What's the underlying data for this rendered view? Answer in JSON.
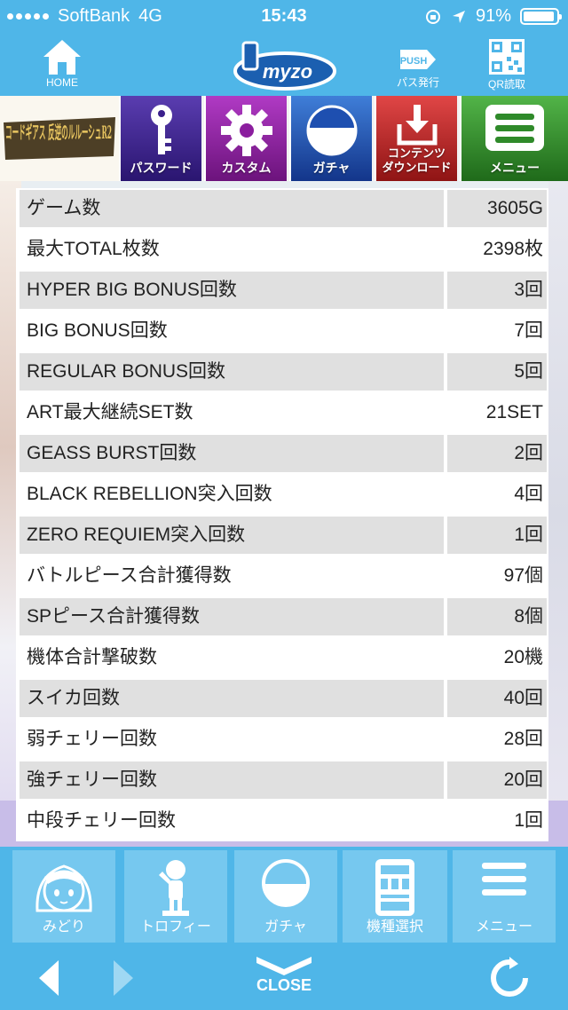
{
  "status_bar": {
    "carrier": "SoftBank",
    "network": "4G",
    "time": "15:43",
    "battery": "91%"
  },
  "header": {
    "home_label": "HOME",
    "logo_text": "myzo",
    "push_icon_text": "PUSH",
    "pass_label": "パス発行",
    "qr_label": "QR読取"
  },
  "category_nav": {
    "title_logo": "コードギアス 反逆のルルーシュR2",
    "items": [
      {
        "label": "パスワード",
        "color": "#3a1f8c",
        "icon": "key-icon"
      },
      {
        "label": "カスタム",
        "color": "#8b1e9e",
        "icon": "gear-icon"
      },
      {
        "label": "ガチャ",
        "color": "#1e4fb0",
        "icon": "gacha-icon"
      },
      {
        "label": "コンテンツ\nダウンロード",
        "color": "#c42b2b",
        "icon": "download-icon"
      },
      {
        "label": "メニュー",
        "color": "#2f8a2a",
        "icon": "menu-icon"
      }
    ]
  },
  "stats": [
    {
      "label": "ゲーム数",
      "value": "3605G"
    },
    {
      "label": "最大TOTAL枚数",
      "value": "2398枚"
    },
    {
      "label": "HYPER BIG BONUS回数",
      "value": "3回"
    },
    {
      "label": "BIG BONUS回数",
      "value": "7回"
    },
    {
      "label": "REGULAR BONUS回数",
      "value": "5回"
    },
    {
      "label": "ART最大継続SET数",
      "value": "21SET"
    },
    {
      "label": "GEASS BURST回数",
      "value": "2回"
    },
    {
      "label": "BLACK REBELLION突入回数",
      "value": "4回"
    },
    {
      "label": "ZERO REQUIEM突入回数",
      "value": "1回"
    },
    {
      "label": "バトルピース合計獲得数",
      "value": "97個"
    },
    {
      "label": "SPピース合計獲得数",
      "value": "8個"
    },
    {
      "label": "機体合計撃破数",
      "value": "20機"
    },
    {
      "label": "スイカ回数",
      "value": "40回"
    },
    {
      "label": "弱チェリー回数",
      "value": "28回"
    },
    {
      "label": "強チェリー回数",
      "value": "20回"
    },
    {
      "label": "中段チェリー回数",
      "value": "1回"
    }
  ],
  "tabs": [
    {
      "label": "みどり",
      "icon": "character-avatar-icon"
    },
    {
      "label": "トロフィー",
      "icon": "trophy-figure-icon"
    },
    {
      "label": "ガチャ",
      "icon": "gacha-icon"
    },
    {
      "label": "機種選択",
      "icon": "slot-machine-icon"
    },
    {
      "label": "メニュー",
      "icon": "menu-icon"
    }
  ],
  "bottom_nav": {
    "close_label": "CLOSE"
  },
  "colors": {
    "brand_blue": "#4fb6e8",
    "tab_blue": "#76c8ef",
    "row_shade": "#e0e0e0"
  }
}
